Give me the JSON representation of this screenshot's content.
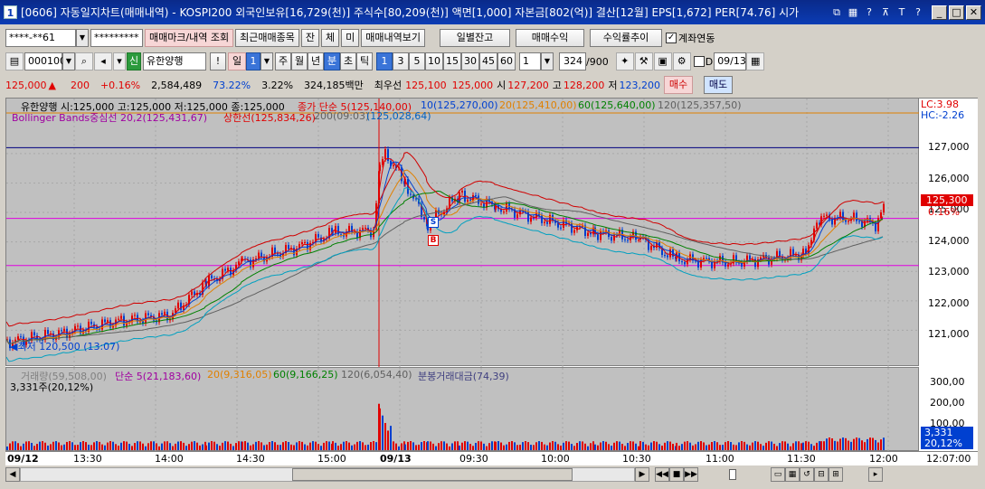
{
  "title": {
    "num": "1",
    "text": "[0606] 자동일지차트(매매내역) - KOSPI200 외국인보유[16,729(천)] 주식수[80,209(천)] 액면[1,000] 자본금[802(억)] 결산[12월] EPS[1,672] PER[74.76] 시가",
    "icons": [
      "?",
      "T",
      "?"
    ]
  },
  "toolbar1": {
    "account": "****-**61",
    "password": "*********",
    "btn_mark": "매매마크/내역 조회",
    "btn_recent": "최근매매종목",
    "chip1": "잔",
    "chip2": "체",
    "chip3": "미",
    "btn_history": "매매내역보기",
    "btn_daily": "일별잔고",
    "btn_profit": "매매수익",
    "btn_rate": "수익률추이",
    "chk_label": "계좌연동"
  },
  "toolbar2": {
    "code": "000100",
    "market": "신",
    "name": "유한양행",
    "excl": "!",
    "period_sel": "일",
    "period_num": "1",
    "periods": [
      "주",
      "월",
      "년",
      "분",
      "초",
      "틱"
    ],
    "minutes": [
      "1",
      "3",
      "5",
      "10",
      "15",
      "30",
      "45",
      "60"
    ],
    "count_sel": "1",
    "count": "324",
    "count_max": "/900",
    "date": "09/13",
    "d_label": "D"
  },
  "quote": {
    "price": "125,000",
    "arrow": "▲",
    "change": "200",
    "rate": "+0.16%",
    "volume": "2,584,489",
    "vr1": "73.22%",
    "vr2": "3.22%",
    "amount": "324,185백만",
    "pref": "최우선",
    "ask": "125,100",
    "bid": "125,000",
    "open_l": "시",
    "open": "127,200",
    "high_l": "고",
    "high": "128,200",
    "low_l": "저",
    "low": "123,200",
    "buy": "매수",
    "sell": "매도"
  },
  "legend": {
    "l1": "유한양행 시:125,000 고:125,000 저:125,000 종:125,000",
    "ma_title": "종가 단순 5(125,140,00)",
    "ma10": "10(125,270,00)",
    "ma20": "20(125,410,00)",
    "ma60": "60(125,640,00)",
    "ma120": "120(125,357,50)",
    "bb": "Bollinger Bands중심선 20,2(125,431,67)",
    "bb_up": "상한선(125,834,26)",
    "bb_mid": "200(09:03)",
    "bb_low": "(125,028,64)",
    "lc": "LC:3.98",
    "hc": "HC:-2.26",
    "low_mark": "최저 120,500 (13:07)",
    "s_mark": "S",
    "b_mark": "B"
  },
  "price_axis": {
    "ticks": [
      "127,000",
      "126,000",
      "125,000",
      "124,000",
      "123,000",
      "122,000",
      "121,000"
    ],
    "cur_price": "125,300",
    "cur_rate": "0.16%"
  },
  "vol_legend": {
    "v": "거래량(59,508,00)",
    "ma5": "단순 5(21,183,60)",
    "ma20": "20(9,316,05)",
    "ma60": "60(9,166,25)",
    "ma120": "120(6,054,40)",
    "amt": "분봉거래대금(74,39)",
    "cur": "3,331주(20,12%)"
  },
  "vol_axis": {
    "ticks": [
      "300,00",
      "200,00",
      "100,00"
    ],
    "cur_vol": "3,331",
    "cur_rate": "20,12%"
  },
  "time_axis": {
    "labels": [
      "09/12",
      "13:30",
      "14:00",
      "14:30",
      "15:00",
      "09/13",
      "09:30",
      "10:00",
      "10:30",
      "11:00",
      "11:30",
      "12:00"
    ],
    "end": "12:07:00"
  },
  "colors": {
    "title_bg": "#0b3cb4",
    "up": "#e00000",
    "down": "#0040d0",
    "magenta": "#e000e0",
    "navy": "#000080"
  },
  "chart_data": {
    "type": "candlestick",
    "ylim": [
      120000,
      128500
    ],
    "open": 127200,
    "high": 128200,
    "low": 123200,
    "close": 125000,
    "day_low": 120500,
    "hlines": [
      127200,
      124800,
      123200
    ]
  }
}
